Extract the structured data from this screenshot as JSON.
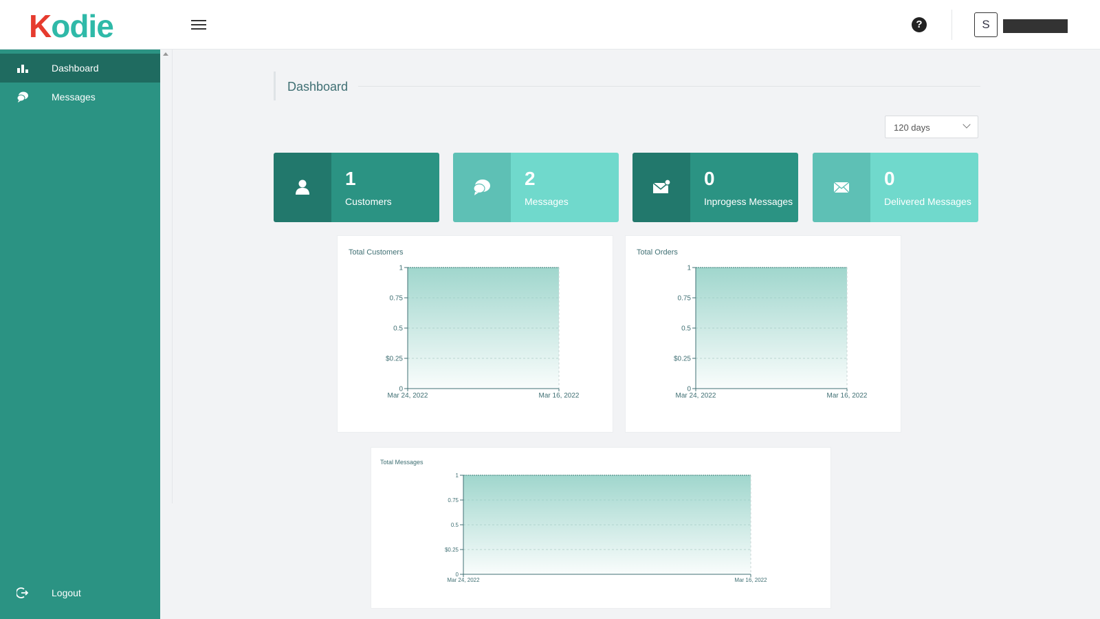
{
  "app": {
    "logo_text": "Kodie",
    "username": "user name (redacted)",
    "avatar_letter": "S"
  },
  "header": {
    "help_icon": "help-circle-icon",
    "menu_icon": "hamburger-icon"
  },
  "sidebar": {
    "items": [
      {
        "label": "Dashboard",
        "icon": "bar-chart-icon",
        "active": true
      },
      {
        "label": "Messages",
        "icon": "chat-bubble-icon",
        "active": false
      }
    ],
    "logout": {
      "label": "Logout",
      "icon": "logout-icon"
    }
  },
  "page": {
    "title": "Dashboard",
    "range_select": {
      "value": "120 days"
    }
  },
  "stats": [
    {
      "value": "1",
      "label": "Customers",
      "icon": "user-icon",
      "style": "dark"
    },
    {
      "value": "2",
      "label": "Messages",
      "icon": "chat-bubble-icon",
      "style": "light"
    },
    {
      "value": "0",
      "label": "Inprogess Messages",
      "icon": "envelope-dot-icon",
      "style": "dark"
    },
    {
      "value": "0",
      "label": "Delivered Messages",
      "icon": "envelope-icon",
      "style": "light"
    }
  ],
  "colors": {
    "sidebar": "#2b9383",
    "sidebar_active": "#1f6b60",
    "accent_light": "#70d9cc",
    "chart_fill": "#8fcfc4"
  },
  "chart_data": [
    {
      "type": "area",
      "title": "Total Customers",
      "x": [
        "Mar 24, 2022",
        "Mar 16, 2022"
      ],
      "y": [
        1,
        1
      ],
      "yticks": [
        "0",
        "$0.25",
        "0.5",
        "0.75",
        "1"
      ],
      "ylim": [
        0,
        1
      ],
      "grid": true
    },
    {
      "type": "area",
      "title": "Total Orders",
      "x": [
        "Mar 24, 2022",
        "Mar 16, 2022"
      ],
      "y": [
        1,
        1
      ],
      "yticks": [
        "0",
        "$0.25",
        "0.5",
        "0.75",
        "1"
      ],
      "ylim": [
        0,
        1
      ],
      "grid": true
    },
    {
      "type": "area",
      "title": "Total Messages",
      "x": [
        "Mar 24, 2022",
        "Mar 16, 2022"
      ],
      "y": [
        1,
        1
      ],
      "yticks": [
        "0",
        "$0.25",
        "0.5",
        "0.75",
        "1"
      ],
      "ylim": [
        0,
        1
      ],
      "grid": true
    }
  ]
}
